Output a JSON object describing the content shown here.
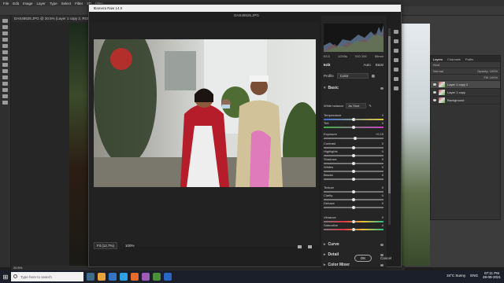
{
  "photoshop": {
    "menu": [
      "File",
      "Edit",
      "Image",
      "Layer",
      "Type",
      "Select",
      "Filter",
      "3D",
      "View"
    ],
    "doc_tab": "DAS45525.JPG @ 20.5% (Layer 1 copy 2, RGB/8) *",
    "status_zoom": "20.5%"
  },
  "dialog": {
    "title": "Camera Raw 14.0",
    "filename": "DAS45525.JPG",
    "fit": "Fit (12.7%)",
    "zoom": "100%",
    "ok": "OK",
    "cancel": "Cancel"
  },
  "panel": {
    "histo_stats": [
      "f/3.5",
      "1/200s",
      "ISO 200",
      "85mm"
    ],
    "edit": "Edit",
    "auto": "Auto",
    "bw": "B&W",
    "profile_label": "Profile",
    "profile_value": "Color",
    "basic": "Basic",
    "wb_label": "White balance",
    "wb_value": "As Shot",
    "sliders": [
      {
        "name": "Temperature",
        "value": "0",
        "pos": 0.5,
        "type": "temp"
      },
      {
        "name": "Tint",
        "value": "0",
        "pos": 0.5,
        "type": "tint"
      },
      {
        "name": "Exposure",
        "value": "+0.15",
        "pos": 0.52,
        "type": "plain"
      },
      {
        "name": "Contrast",
        "value": "0",
        "pos": 0.5,
        "type": "plain"
      },
      {
        "name": "Highlights",
        "value": "0",
        "pos": 0.5,
        "type": "plain"
      },
      {
        "name": "Shadows",
        "value": "0",
        "pos": 0.5,
        "type": "plain"
      },
      {
        "name": "Whites",
        "value": "0",
        "pos": 0.5,
        "type": "plain"
      },
      {
        "name": "Blacks",
        "value": "0",
        "pos": 0.5,
        "type": "plain"
      },
      {
        "name": "Texture",
        "value": "0",
        "pos": 0.5,
        "type": "plain"
      },
      {
        "name": "Clarity",
        "value": "0",
        "pos": 0.5,
        "type": "plain"
      },
      {
        "name": "Dehaze",
        "value": "0",
        "pos": 0.5,
        "type": "plain"
      },
      {
        "name": "Vibrance",
        "value": "0",
        "pos": 0.5,
        "type": "vib"
      },
      {
        "name": "Saturation",
        "value": "0",
        "pos": 0.5,
        "type": "sat"
      }
    ],
    "sections": [
      "Curve",
      "Detail",
      "Color Mixer"
    ]
  },
  "layers": {
    "tabs": [
      "Layers",
      "Channels",
      "Paths"
    ],
    "kind": "Kind",
    "mode": "Normal",
    "opacity": "Opacity: 100%",
    "fill": "Fill: 100%",
    "items": [
      "Layer 1 copy 2",
      "Layer 1 copy",
      "Background"
    ]
  },
  "taskbar": {
    "search": "Type here to search",
    "weather": "34°C Sunny",
    "lang": "ENG",
    "time": "07:11 PM",
    "date": "28-09-2021"
  },
  "colors": {
    "accent": "#3b82f6",
    "dialog_bg": "#1f1f1f"
  }
}
